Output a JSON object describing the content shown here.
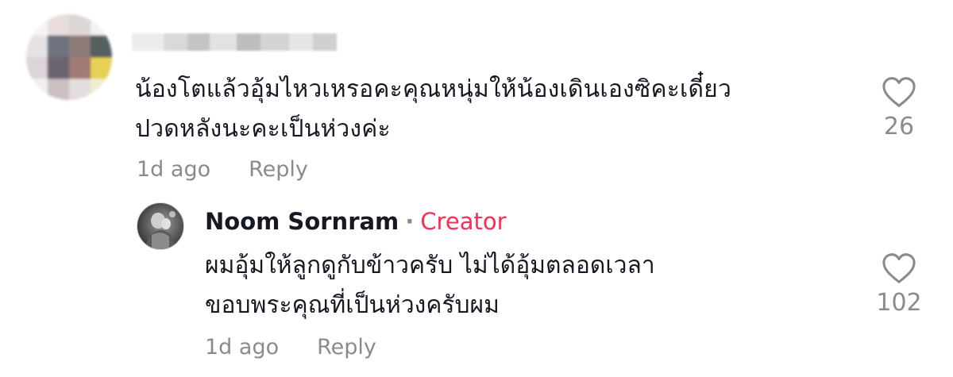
{
  "comment": {
    "text_line1": "น้องโตแล้วอุ้มไหวเหรอคะคุณหนุ่มให้น้องเดินเองซิคะเดี๋ยว",
    "text_line2": "ปวดหลังนะคะเป็นห่วงค่ะ",
    "time": "1d ago",
    "reply_label": "Reply",
    "like_count": "26",
    "like_icon": "heart-outline-icon"
  },
  "reply": {
    "username": "Noom Sornram",
    "separator": "·",
    "badge": "Creator",
    "text_line1": "ผมอุ้มให้ลูกดูกับข้าวครับ ไม่ได้อุ้มตลอดเวลา",
    "text_line2": "ขอบพระคุณที่เป็นห่วงครับผม",
    "time": "1d ago",
    "reply_label": "Reply",
    "like_count": "102",
    "like_icon": "heart-outline-icon"
  },
  "colors": {
    "text_primary": "#161823",
    "text_secondary": "#8a8b91",
    "creator_accent": "#fe2c55"
  }
}
